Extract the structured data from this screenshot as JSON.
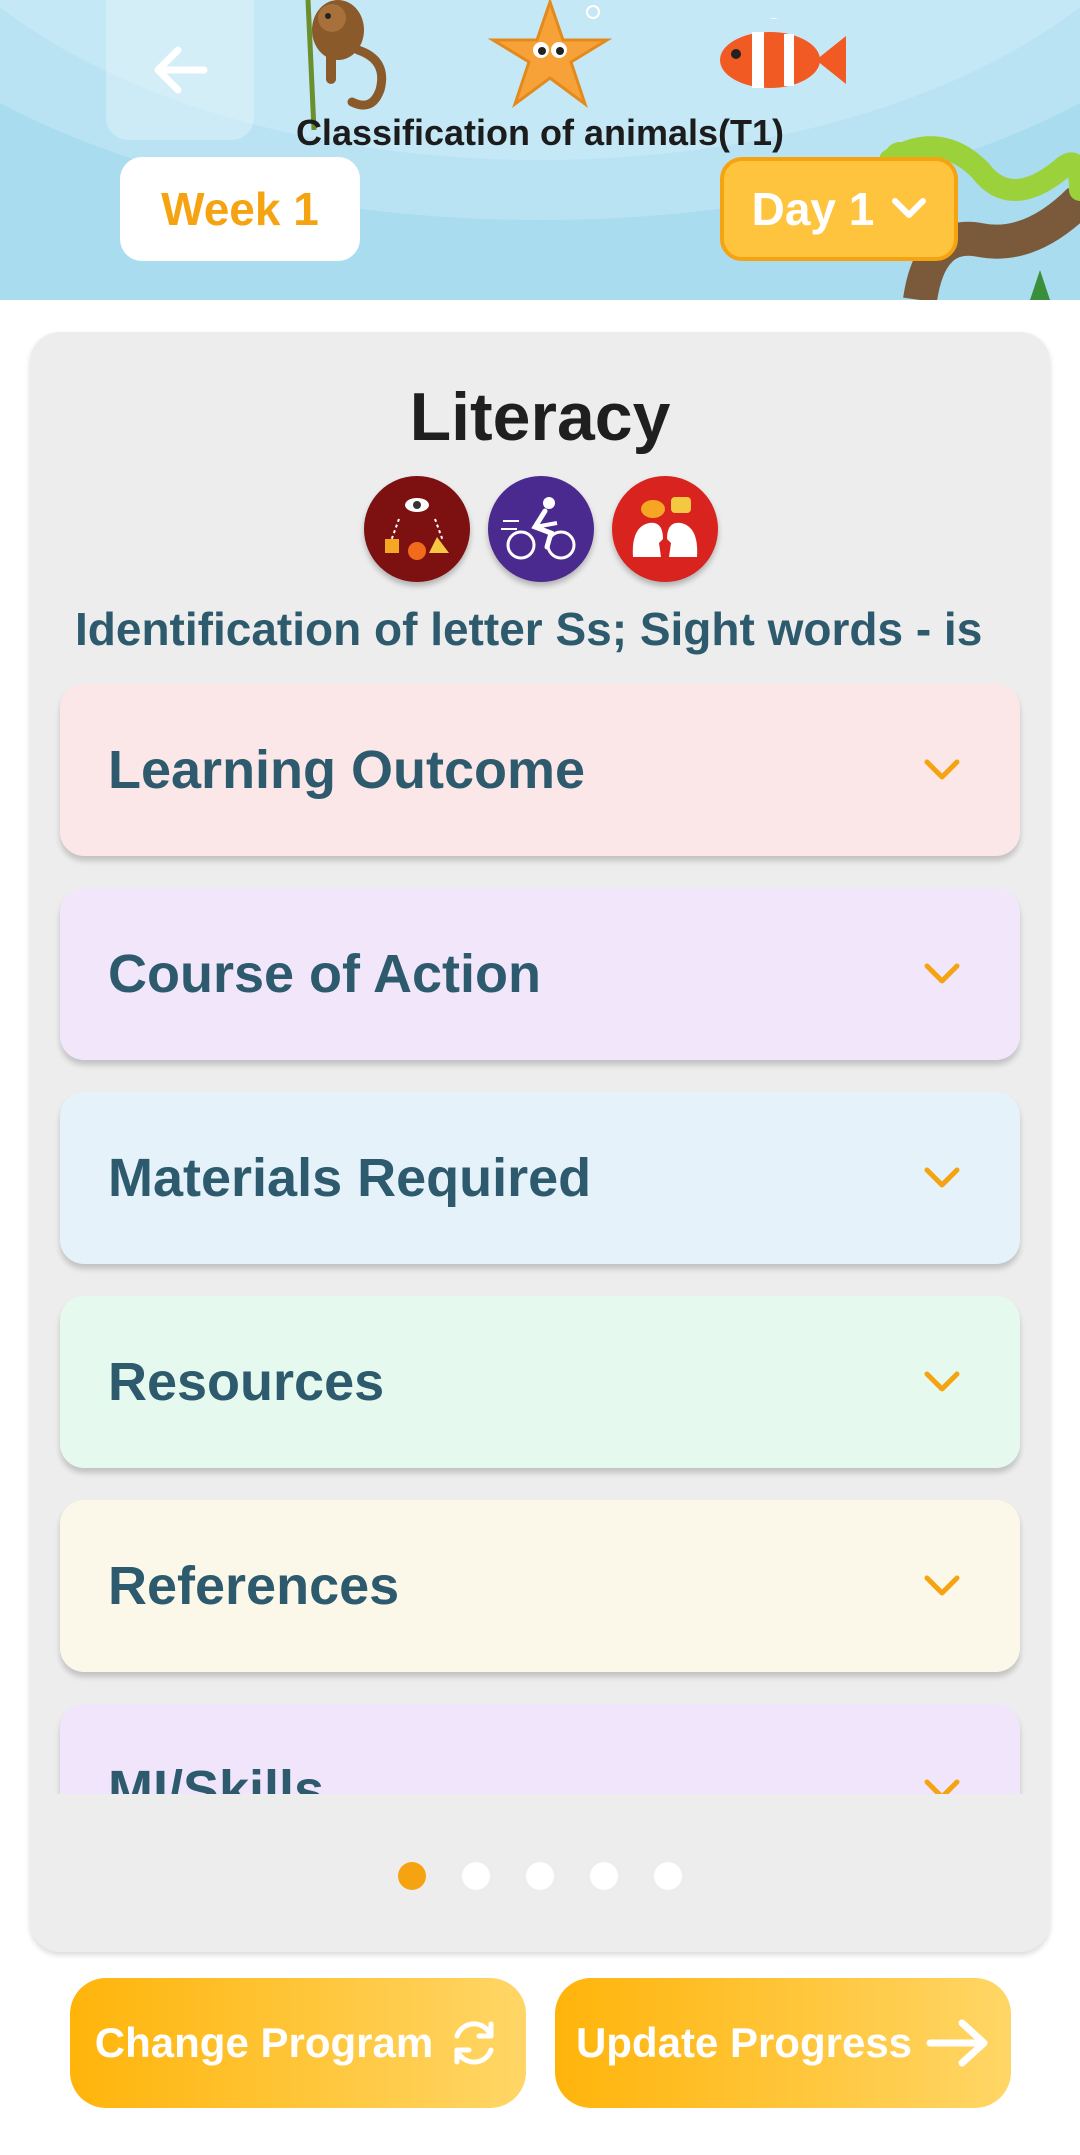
{
  "header": {
    "title": "Classification of animals(T1)",
    "week_label": "Week 1",
    "day_label": "Day 1",
    "back_icon": "arrow-left-icon",
    "decorations": [
      "monkey-illustration",
      "starfish-illustration",
      "clownfish-illustration",
      "snake-illustration"
    ]
  },
  "card": {
    "subject": "Literacy",
    "skill_icons": [
      "visual-spatial-icon",
      "bodily-kinesthetic-icon",
      "interpersonal-icon"
    ],
    "topic": "Identification of letter Ss; Sight words - is",
    "sections": [
      {
        "label": "Learning Outcome",
        "color": "#fbe7e8"
      },
      {
        "label": "Course of Action",
        "color": "#f2e6fa"
      },
      {
        "label": "Materials Required",
        "color": "#e5f2fa"
      },
      {
        "label": "Resources",
        "color": "#e6f9ee"
      },
      {
        "label": "References",
        "color": "#fbf8e9"
      },
      {
        "label": "MI/Skills",
        "color": "#f0e5fa"
      }
    ],
    "pager": {
      "count": 5,
      "active_index": 0
    }
  },
  "actions": {
    "change_program": "Change Program",
    "update_progress": "Update Progress"
  },
  "colors": {
    "accent": "#f5a310",
    "header_bg": "#a9dcef",
    "text_dark": "#2e5a6e"
  }
}
